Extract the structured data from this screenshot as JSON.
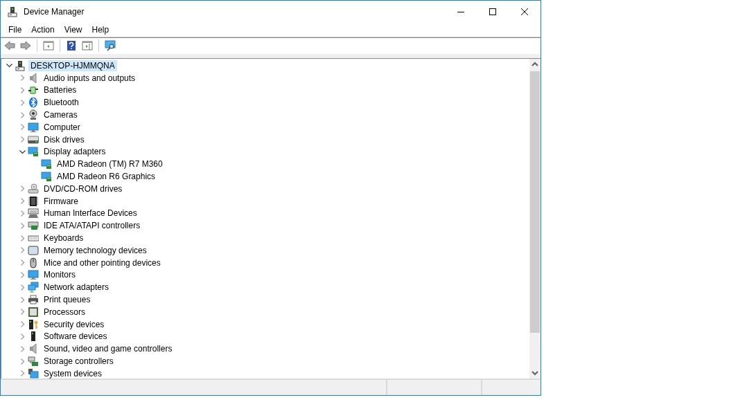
{
  "window": {
    "title": "Device Manager"
  },
  "menu": [
    "File",
    "Action",
    "View",
    "Help"
  ],
  "tree": {
    "items": [
      {
        "label": "DESKTOP-HJMMQNA",
        "kind": "pc",
        "selected": true,
        "expanded": true,
        "children": [
          {
            "label": "Audio inputs and outputs",
            "kind": "audio",
            "selected": false,
            "expanded": false
          },
          {
            "label": "Batteries",
            "kind": "battery",
            "selected": false,
            "expanded": false
          },
          {
            "label": "Bluetooth",
            "kind": "bluetooth",
            "selected": false,
            "expanded": false
          },
          {
            "label": "Cameras",
            "kind": "camera",
            "selected": false,
            "expanded": false
          },
          {
            "label": "Computer",
            "kind": "monitor",
            "selected": false,
            "expanded": false
          },
          {
            "label": "Disk drives",
            "kind": "disk",
            "selected": false,
            "expanded": false
          },
          {
            "label": "Display adapters",
            "kind": "display",
            "selected": false,
            "expanded": true,
            "children": [
              {
                "label": "AMD Radeon (TM) R7 M360",
                "kind": "display",
                "selected": false
              },
              {
                "label": "AMD Radeon R6 Graphics",
                "kind": "display",
                "selected": false
              }
            ]
          },
          {
            "label": "DVD/CD-ROM drives",
            "kind": "dvd",
            "selected": false,
            "expanded": false
          },
          {
            "label": "Firmware",
            "kind": "firmware",
            "selected": false,
            "expanded": false
          },
          {
            "label": "Human Interface Devices",
            "kind": "hid",
            "selected": false,
            "expanded": false
          },
          {
            "label": "IDE ATA/ATAPI controllers",
            "kind": "ide",
            "selected": false,
            "expanded": false
          },
          {
            "label": "Keyboards",
            "kind": "keyboard",
            "selected": false,
            "expanded": false
          },
          {
            "label": "Memory technology devices",
            "kind": "memory",
            "selected": false,
            "expanded": false
          },
          {
            "label": "Mice and other pointing devices",
            "kind": "mouse",
            "selected": false,
            "expanded": false
          },
          {
            "label": "Monitors",
            "kind": "monitor",
            "selected": false,
            "expanded": false
          },
          {
            "label": "Network adapters",
            "kind": "network",
            "selected": false,
            "expanded": false
          },
          {
            "label": "Print queues",
            "kind": "printer",
            "selected": false,
            "expanded": false
          },
          {
            "label": "Processors",
            "kind": "processor",
            "selected": false,
            "expanded": false
          },
          {
            "label": "Security devices",
            "kind": "security",
            "selected": false,
            "expanded": false
          },
          {
            "label": "Software devices",
            "kind": "software",
            "selected": false,
            "expanded": false
          },
          {
            "label": "Sound, video and game controllers",
            "kind": "audio",
            "selected": false,
            "expanded": false
          },
          {
            "label": "Storage controllers",
            "kind": "storage",
            "selected": false,
            "expanded": false
          },
          {
            "label": "System devices",
            "kind": "system",
            "selected": false,
            "expanded": false
          }
        ]
      }
    ]
  }
}
